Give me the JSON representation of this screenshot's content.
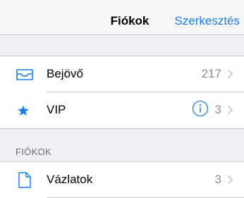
{
  "navbar": {
    "title": "Fiókok",
    "edit_label": "Szerkesztés"
  },
  "mailboxes": {
    "inbox": {
      "label": "Bejövő",
      "count": "217",
      "icon": "inbox-tray-icon"
    },
    "vip": {
      "label": "VIP",
      "count": "3",
      "icon": "star-icon",
      "info_icon": "info-circle-icon"
    }
  },
  "accounts_section": {
    "header": "FIÓKOK",
    "items": [
      {
        "label": "Vázlatok",
        "count": "3",
        "icon": "document-icon"
      }
    ]
  },
  "colors": {
    "accent": "#1a7ef2",
    "secondary_text": "#8e8e93",
    "group_background": "#efeff4",
    "separator": "#c8c7cc"
  }
}
